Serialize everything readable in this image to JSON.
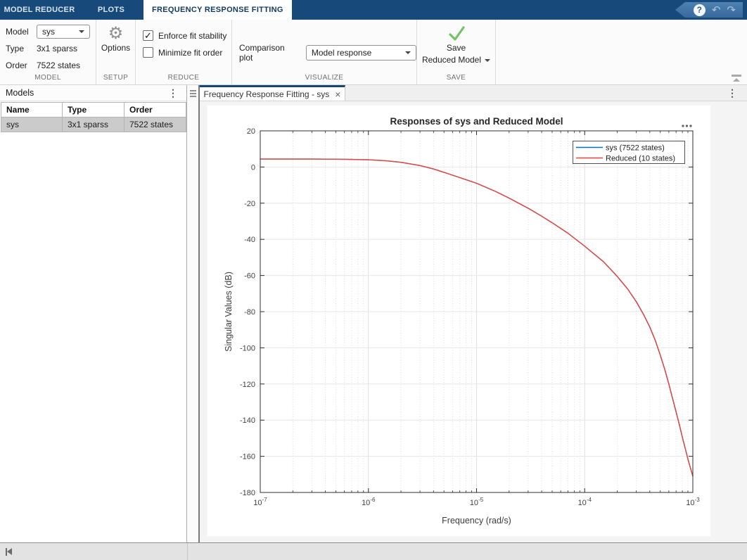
{
  "topbar": {
    "tabs": [
      {
        "label": "MODEL REDUCER"
      },
      {
        "label": "PLOTS"
      },
      {
        "label": "FREQUENCY RESPONSE FITTING"
      }
    ],
    "help_label": "?",
    "undo_glyph": "↶",
    "redo_glyph": "↷"
  },
  "toolbar": {
    "model_label": "Model",
    "model_value": "sys",
    "type_label": "Type",
    "type_value": "3x1 sparss",
    "order_label": "Order",
    "order_value": "7522 states",
    "options_icon": "⚙",
    "options_label": "Options",
    "enforce_fit_stability_label": "Enforce fit stability",
    "enforce_fit_stability_checked": true,
    "minimize_fit_order_label": "Minimize fit order",
    "minimize_fit_order_checked": false,
    "comparison_plot_label": "Comparison plot",
    "comparison_plot_value": "Model response",
    "save_line1": "Save",
    "save_line2": "Reduced Model",
    "sections": {
      "model": "MODEL",
      "setup": "SETUP",
      "reduce": "REDUCE",
      "visualize": "VISUALIZE",
      "save": "SAVE"
    }
  },
  "models_panel": {
    "title": "Models",
    "menu_glyph": "⋮",
    "headers": [
      "Name",
      "Type",
      "Order"
    ],
    "rows": [
      {
        "name": "sys",
        "type": "3x1 sparss",
        "order": "7522 states"
      }
    ]
  },
  "document": {
    "tab_title": "Frequency Response Fitting - sys",
    "close_glyph": "×",
    "menu_glyph": "⋮",
    "chart_menu_glyph": "..."
  },
  "chart_data": {
    "type": "line",
    "title": "Responses of sys and Reduced Model",
    "xlabel": "Frequency (rad/s)",
    "ylabel": "Singular Values (dB)",
    "x_scale": "log",
    "xlim": [
      1e-07,
      0.001
    ],
    "ylim": [
      -180,
      20
    ],
    "y_ticks": [
      20,
      0,
      -20,
      -40,
      -60,
      -80,
      -100,
      -120,
      -140,
      -160,
      -180
    ],
    "x_tick_exponents": [
      -7,
      -6,
      -5,
      -4,
      -3
    ],
    "grid": true,
    "legend_position": "northeast",
    "x": [
      1e-07,
      1.5e-07,
      2e-07,
      3e-07,
      5e-07,
      7e-07,
      1e-06,
      1.5e-06,
      2e-06,
      3e-06,
      4e-06,
      5e-06,
      6e-06,
      8e-06,
      1e-05,
      1.5e-05,
      2e-05,
      3e-05,
      4e-05,
      5e-05,
      7e-05,
      0.0001,
      0.00015,
      0.0002,
      0.00025,
      0.0003,
      0.00035,
      0.0004,
      0.00045,
      0.0005,
      0.00055,
      0.0006,
      0.00065,
      0.0007,
      0.00075,
      0.0008,
      0.00085,
      0.0009,
      0.00095,
      0.001
    ],
    "series": [
      {
        "name": "sys (7522 states)",
        "color": "#0072bd",
        "values": [
          4.4,
          4.4,
          4.4,
          4.4,
          4.3,
          4.2,
          4.0,
          3.4,
          2.6,
          0.8,
          -1.1,
          -2.9,
          -4.5,
          -7.0,
          -9.0,
          -13.5,
          -17.2,
          -22.8,
          -27.2,
          -30.8,
          -36.6,
          -43.8,
          -52.5,
          -60.5,
          -67.5,
          -74.5,
          -81.5,
          -88.5,
          -96.0,
          -104.0,
          -112.0,
          -120.0,
          -128.0,
          -135.5,
          -142.5,
          -149.5,
          -155.5,
          -161.5,
          -166.5,
          -171.0
        ]
      },
      {
        "name": "Reduced (10 states)",
        "color": "#e8433c",
        "values": [
          4.4,
          4.4,
          4.4,
          4.4,
          4.3,
          4.2,
          4.0,
          3.4,
          2.6,
          0.8,
          -1.1,
          -2.9,
          -4.5,
          -7.0,
          -9.0,
          -13.5,
          -17.2,
          -22.8,
          -27.2,
          -30.8,
          -36.6,
          -43.8,
          -52.5,
          -60.5,
          -67.5,
          -74.5,
          -81.5,
          -88.5,
          -96.0,
          -104.0,
          -112.0,
          -120.0,
          -128.0,
          -135.5,
          -142.5,
          -149.5,
          -155.5,
          -161.5,
          -166.5,
          -171.0
        ]
      }
    ]
  }
}
